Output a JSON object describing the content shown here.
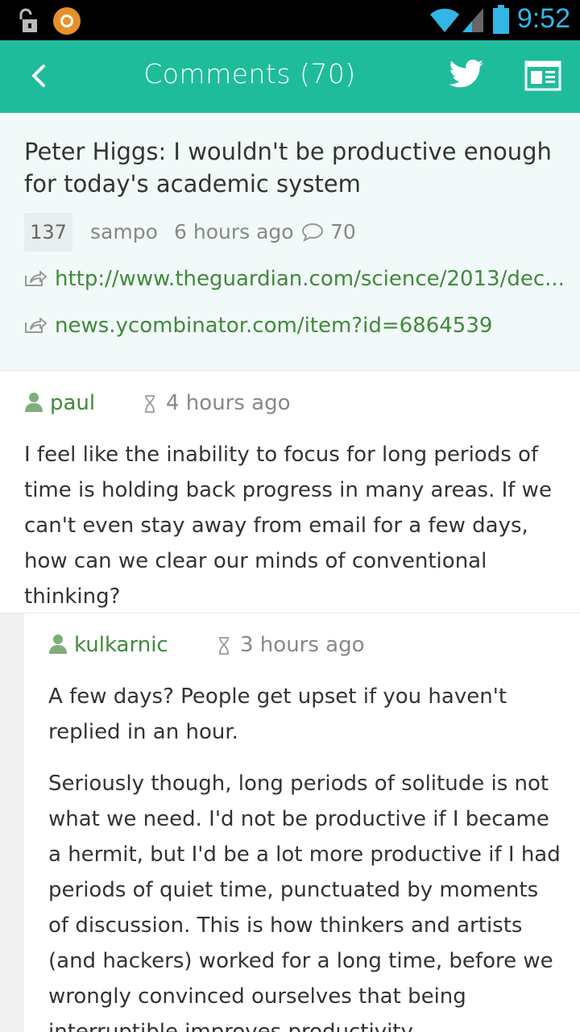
{
  "status_bar": {
    "time": "9:52",
    "icons": [
      "unlock-icon",
      "app-notification-icon",
      "wifi-icon",
      "signal-icon",
      "battery-icon"
    ],
    "accent_color": "#33b5e5"
  },
  "app_bar": {
    "title": "Comments (70)",
    "background_color": "#1fbc9c",
    "icons": [
      "back-icon",
      "twitter-icon",
      "newspaper-icon"
    ]
  },
  "story": {
    "title": "Peter Higgs: I wouldn't be productive enough for today's academic system",
    "points": "137",
    "author": "sampo",
    "age": "6 hours ago",
    "comment_count": "70",
    "article_url": "http://www.theguardian.com/science/2013/dec...",
    "hn_url": "news.ycombinator.com/item?id=6864539",
    "link_color": "#3f8a3a"
  },
  "comments": [
    {
      "user": "paul",
      "age": "4 hours ago",
      "paragraphs": [
        "I feel like the inability to focus for long periods of time is holding back progress in many areas. If we can't even stay away from email for a few days, how can we clear our minds of conventional thinking?"
      ]
    },
    {
      "user": "kulkarnic",
      "age": "3 hours ago",
      "paragraphs": [
        "A few days? People get upset if you haven't replied in an hour.",
        "Seriously though, long periods of solitude is not what we need. I'd not be productive if I became a hermit, but I'd be a lot more productive if I had periods of quiet time, punctuated by moments of discussion. This is how thinkers and artists (and hackers) worked for a long time, before we wrongly convinced ourselves that being interruptible improves productivity."
      ]
    }
  ]
}
